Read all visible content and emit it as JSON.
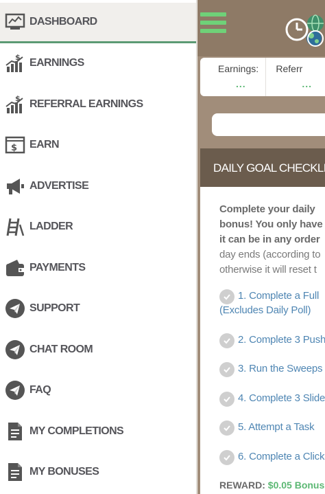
{
  "sidebar": {
    "items": [
      {
        "label": "DASHBOARD",
        "icon": "chart-monitor-icon",
        "active": true
      },
      {
        "label": "EARNINGS",
        "icon": "money-bars-icon"
      },
      {
        "label": "REFERRAL EARNINGS",
        "icon": "money-bars-icon"
      },
      {
        "label": "EARN",
        "icon": "dollar-window-icon"
      },
      {
        "label": "ADVERTISE",
        "icon": "megaphone-icon"
      },
      {
        "label": "LADDER",
        "icon": "ladder-icon"
      },
      {
        "label": "PAYMENTS",
        "icon": "wallet-icon"
      },
      {
        "label": "SUPPORT",
        "icon": "paper-plane-icon"
      },
      {
        "label": "CHAT ROOM",
        "icon": "paper-plane-icon"
      },
      {
        "label": "FAQ",
        "icon": "paper-plane-icon"
      },
      {
        "label": "MY COMPLETIONS",
        "icon": "document-icon"
      },
      {
        "label": "MY BONUSES",
        "icon": "document-icon"
      }
    ]
  },
  "topbar": {
    "menu_icon": "hamburger-icon",
    "clock_icon": "clock-icon",
    "globe_icon": "globe-icon"
  },
  "stats": {
    "earnings_label": "Earnings:",
    "earnings_value": "...",
    "referrals_label": "Referr",
    "referrals_value": "..."
  },
  "checklist": {
    "header": "DAILY GOAL CHECKLIS",
    "intro_line1": "Complete your daily",
    "intro_line2": "bonus! You only have",
    "intro_line3": "it can be in any order",
    "intro_line4": "day ends (according to",
    "intro_line5": "otherwise it will reset t",
    "tasks": [
      "1. Complete a Full",
      "2. Complete 3 Push",
      "3. Run the Sweeps",
      "4. Complete 3 Slide",
      "5. Attempt a Task",
      "6. Complete a Click"
    ],
    "task1_continuation": "(Excludes Daily Poll)",
    "reward_label": "REWARD:",
    "reward_value": "$0.05 Bonus"
  },
  "colors": {
    "accent_green": "#5cb874",
    "header_brown": "#6b5c4d",
    "main_bg": "#a18d7a",
    "task_blue": "#4f86b3"
  }
}
